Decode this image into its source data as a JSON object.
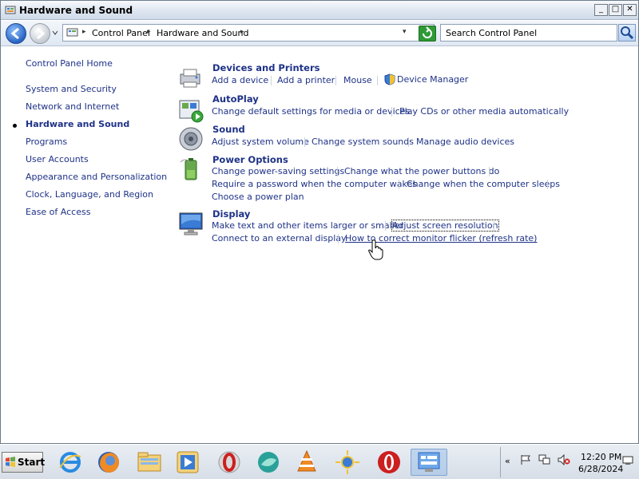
{
  "window": {
    "title": "Hardware and Sound"
  },
  "window_buttons": {
    "minimize": "_",
    "maximize": "□",
    "close": "✕"
  },
  "address": {
    "crumb_control_panel": "Control Panel",
    "crumb_hardware_sound": "Hardware and Sound",
    "arrow": "▸",
    "dropdown": "▾"
  },
  "search": {
    "placeholder": "Search Control Panel"
  },
  "sidebar": {
    "home": "Control Panel Home",
    "items": [
      "System and Security",
      "Network and Internet",
      "Hardware and Sound",
      "Programs",
      "User Accounts",
      "Appearance and Personalization",
      "Clock, Language, and Region",
      "Ease of Access"
    ],
    "active_index": 2
  },
  "categories": {
    "devices": {
      "title": "Devices and Printers",
      "tasks": [
        "Add a device",
        "Add a printer",
        "Mouse",
        "Device Manager"
      ]
    },
    "autoplay": {
      "title": "AutoPlay",
      "tasks": [
        "Change default settings for media or devices",
        "Play CDs or other media automatically"
      ]
    },
    "sound": {
      "title": "Sound",
      "tasks": [
        "Adjust system volume",
        "Change system sounds",
        "Manage audio devices"
      ]
    },
    "power": {
      "title": "Power Options",
      "tasks": [
        "Change power-saving settings",
        "Change what the power buttons do",
        "Require a password when the computer wakes",
        "Change when the computer sleeps",
        "Choose a power plan"
      ]
    },
    "display": {
      "title": "Display",
      "tasks": [
        "Make text and other items larger or smaller",
        "Adjust screen resolution",
        "Connect to an external display",
        "How to correct monitor flicker (refresh rate)"
      ]
    }
  },
  "taskbar": {
    "start_label": "Start",
    "apps": [
      "internet-explorer-icon",
      "firefox-icon",
      "explorer-icon",
      "media-player-icon",
      "opera-icon",
      "browser-icon",
      "vlc-icon",
      "weather-icon",
      "opera-red-icon",
      "control-panel-icon"
    ],
    "clock_time": "12:20 PM",
    "clock_date": "6/28/2024",
    "tray_chevron": "«"
  },
  "colors": {
    "link": "#1e3287",
    "taskbar": "#d7dee7",
    "accent": "#2a64c3"
  }
}
